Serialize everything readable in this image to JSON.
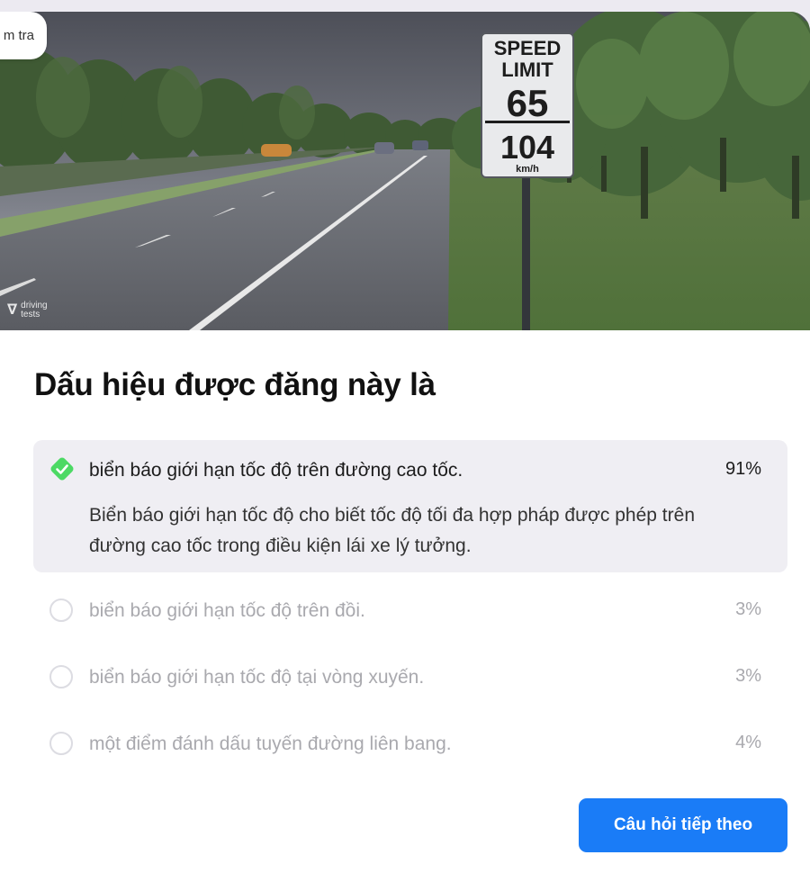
{
  "hero": {
    "tab_label": "m tra",
    "sign_line1": "SPEED",
    "sign_line2": "LIMIT",
    "sign_mph": "65",
    "sign_kmh": "104",
    "sign_unit": "km/h",
    "watermark_line1": "driving",
    "watermark_line2": "tests"
  },
  "question": {
    "title": "Dấu hiệu được đăng này là"
  },
  "answers": [
    {
      "label": "biển báo giới hạn tốc độ trên đường cao tốc.",
      "percent": "91%",
      "correct": true,
      "explanation": "Biển báo giới hạn tốc độ cho biết tốc độ tối đa hợp pháp được phép trên đường cao tốc trong điều kiện lái xe lý tưởng."
    },
    {
      "label": "biển báo giới hạn tốc độ trên đồi.",
      "percent": "3%",
      "correct": false
    },
    {
      "label": "biển báo giới hạn tốc độ tại vòng xuyến.",
      "percent": "3%",
      "correct": false
    },
    {
      "label": "một điểm đánh dấu tuyến đường liên bang.",
      "percent": "4%",
      "correct": false
    }
  ],
  "footer": {
    "next_label": "Câu hỏi tiếp theo"
  },
  "colors": {
    "accent": "#1a7cf7",
    "correct": "#4cd964",
    "selected_bg": "#efeef3"
  }
}
